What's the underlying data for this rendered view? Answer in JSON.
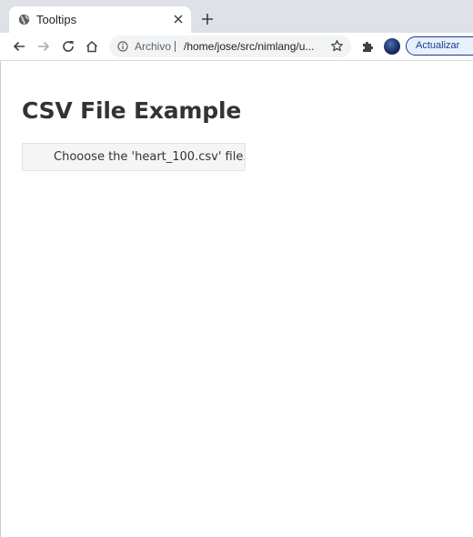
{
  "browser": {
    "tab": {
      "title": "Tooltips",
      "favicon": "globe-icon"
    },
    "new_tab_icon": "plus-icon",
    "toolbar": {
      "back_icon": "arrow-left-icon",
      "forward_icon": "arrow-right-icon",
      "reload_icon": "reload-icon",
      "home_icon": "home-icon",
      "address": {
        "info_icon": "info-icon",
        "scheme_label": "Archivo",
        "url": "/home/jose/src/nimlang/u...",
        "bookmark_icon": "star-icon"
      },
      "extensions_icon": "puzzle-icon",
      "profile_icon": "avatar",
      "update_label": "Actualizar"
    }
  },
  "page": {
    "title": "CSV File Example",
    "file_button_label": "Chooose the 'heart_100.csv' file..."
  }
}
